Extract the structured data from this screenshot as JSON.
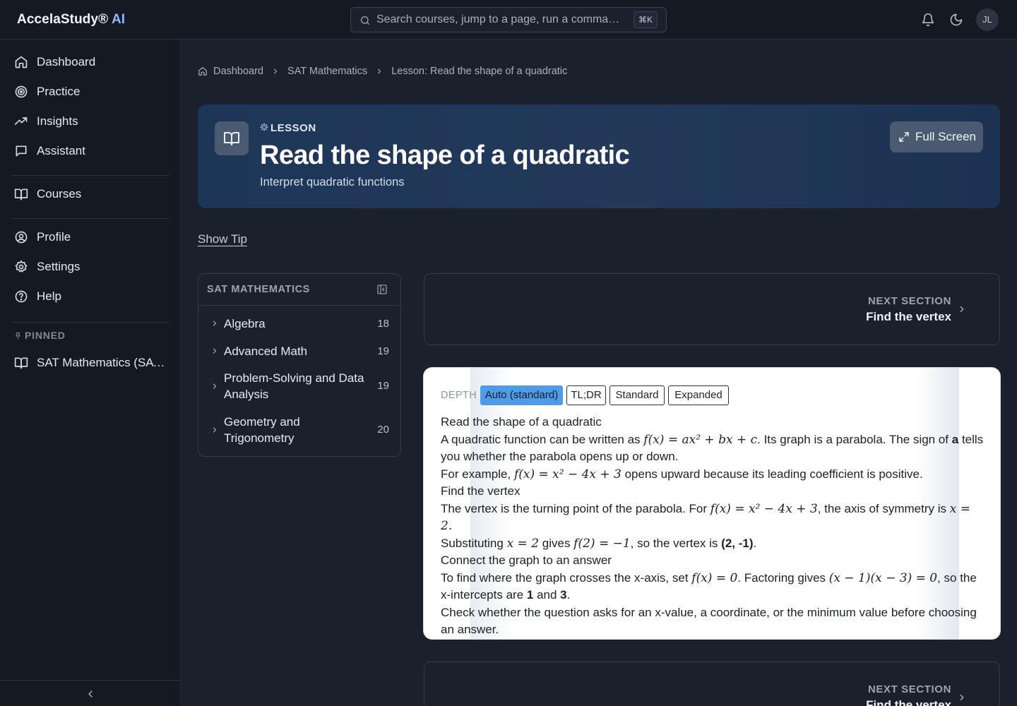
{
  "app": {
    "brand": "AccelaStudy®",
    "brand_ai": "AI"
  },
  "search": {
    "placeholder": "Search courses, jump to a page, run a comma…",
    "shortcut": "⌘K"
  },
  "user": {
    "initials": "JL"
  },
  "sidebar": {
    "items": [
      {
        "label": "Dashboard",
        "icon": "home-icon"
      },
      {
        "label": "Practice",
        "icon": "target-icon"
      },
      {
        "label": "Insights",
        "icon": "trending-up-icon"
      },
      {
        "label": "Assistant",
        "icon": "chat-icon"
      },
      {
        "label": "Courses",
        "icon": "book-open-icon"
      },
      {
        "label": "Profile",
        "icon": "user-circle-icon"
      },
      {
        "label": "Settings",
        "icon": "gear-icon"
      },
      {
        "label": "Help",
        "icon": "help-circle-icon"
      }
    ],
    "pinned_heading": "PINNED",
    "pinned": [
      {
        "label": "SAT Mathematics (SAT Math)",
        "icon": "book-open-icon"
      }
    ]
  },
  "breadcrumb": [
    "Dashboard",
    "SAT Mathematics",
    "Lesson: Read the shape of a quadratic"
  ],
  "hero": {
    "kicker": "LESSON",
    "title": "Read the shape of a quadratic",
    "subtitle": "Interpret quadratic functions",
    "fullscreen_label": "Full Screen"
  },
  "show_tip": "Show Tip",
  "course_panel": {
    "title": "SAT MATHEMATICS",
    "topics": [
      {
        "label": "Algebra",
        "count": "18"
      },
      {
        "label": "Advanced Math",
        "count": "19"
      },
      {
        "label": "Problem-Solving and Data Analysis",
        "count": "19"
      },
      {
        "label": "Geometry and Trigonometry",
        "count": "20"
      }
    ]
  },
  "next_section": {
    "kicker": "NEXT SECTION",
    "title": "Find the vertex"
  },
  "depth": {
    "label": "DEPTH",
    "options": [
      "Auto (standard)",
      "TL;DR",
      "Standard",
      "Expanded"
    ],
    "selected": "Auto (standard)"
  },
  "lesson": {
    "h1": "Read the shape of a quadratic",
    "p1_a": "A quadratic function can be written as ",
    "p1_math": "f(x) = ax² + bx + c",
    "p1_b": ". Its graph is a parabola. The sign of ",
    "p1_bold": "a",
    "p1_c": " tells you whether the parabola opens up or down.",
    "p2_a": "For example, ",
    "p2_math": "f(x) = x² − 4x + 3",
    "p2_b": " opens upward because its leading coefficient is positive.",
    "h2": "Find the vertex",
    "p3_a": "The vertex is the turning point of the parabola. For ",
    "p3_math1": "f(x) = x² − 4x + 3",
    "p3_b": ", the axis of symmetry is ",
    "p3_math2": "x = 2.",
    "p4_a": "Substituting ",
    "p4_math1": "x = 2",
    "p4_b": " gives ",
    "p4_math2": "f(2) = −1",
    "p4_c": ", so the vertex is ",
    "p4_bold": "(2, -1)",
    "p4_d": ".",
    "h3": "Connect the graph to an answer",
    "p5_a": "To find where the graph crosses the x-axis, set ",
    "p5_math1": "f(x) = 0",
    "p5_b": ". Factoring gives ",
    "p5_math2": "(x − 1)(x − 3) = 0",
    "p5_c": ", so the x-intercepts are ",
    "p5_bold1": "1",
    "p5_d": " and ",
    "p5_bold2": "3",
    "p5_e": ".",
    "p6": "Check whether the question asks for an x-value, a coordinate, or the minimum value before choosing an answer."
  },
  "colors": {
    "accent": "#4f9be6",
    "hero_bg": "#1d3557",
    "page_bg": "#1a202c",
    "sidebar_bg": "#141922"
  }
}
